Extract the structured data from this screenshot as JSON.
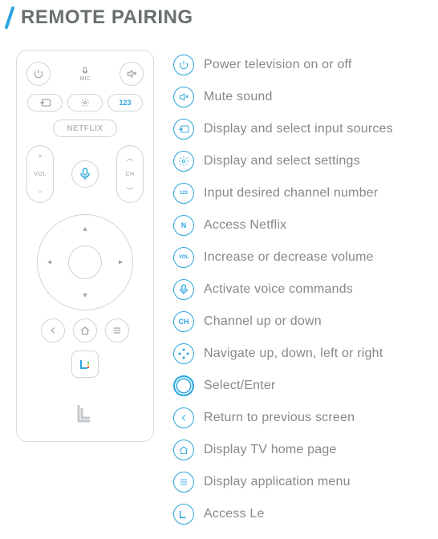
{
  "title": "REMOTE PAIRING",
  "remote": {
    "mic_label": "MIC",
    "ch123": "123",
    "netflix": "NETFLIX",
    "vol": "VOL",
    "ch": "CH"
  },
  "legend": [
    {
      "icon": "power",
      "label": "Power television on or off"
    },
    {
      "icon": "mute",
      "label": "Mute sound"
    },
    {
      "icon": "input",
      "label": "Display and select input sources"
    },
    {
      "icon": "gear",
      "label": "Display and select settings"
    },
    {
      "icon": "123",
      "label": "Input desired channel number"
    },
    {
      "icon": "N",
      "label": "Access Netflix"
    },
    {
      "icon": "VOL",
      "label": "Increase or decrease volume"
    },
    {
      "icon": "micbtn",
      "label": "Activate voice commands"
    },
    {
      "icon": "CH",
      "label": "Channel up or down"
    },
    {
      "icon": "nav",
      "label": "Navigate up, down, left or right"
    },
    {
      "icon": "select",
      "label": "Select/Enter"
    },
    {
      "icon": "back",
      "label": "Return to previous screen"
    },
    {
      "icon": "home",
      "label": "Display TV home page"
    },
    {
      "icon": "menu",
      "label": "Display application menu"
    },
    {
      "icon": "le",
      "label": "Access Le"
    }
  ]
}
